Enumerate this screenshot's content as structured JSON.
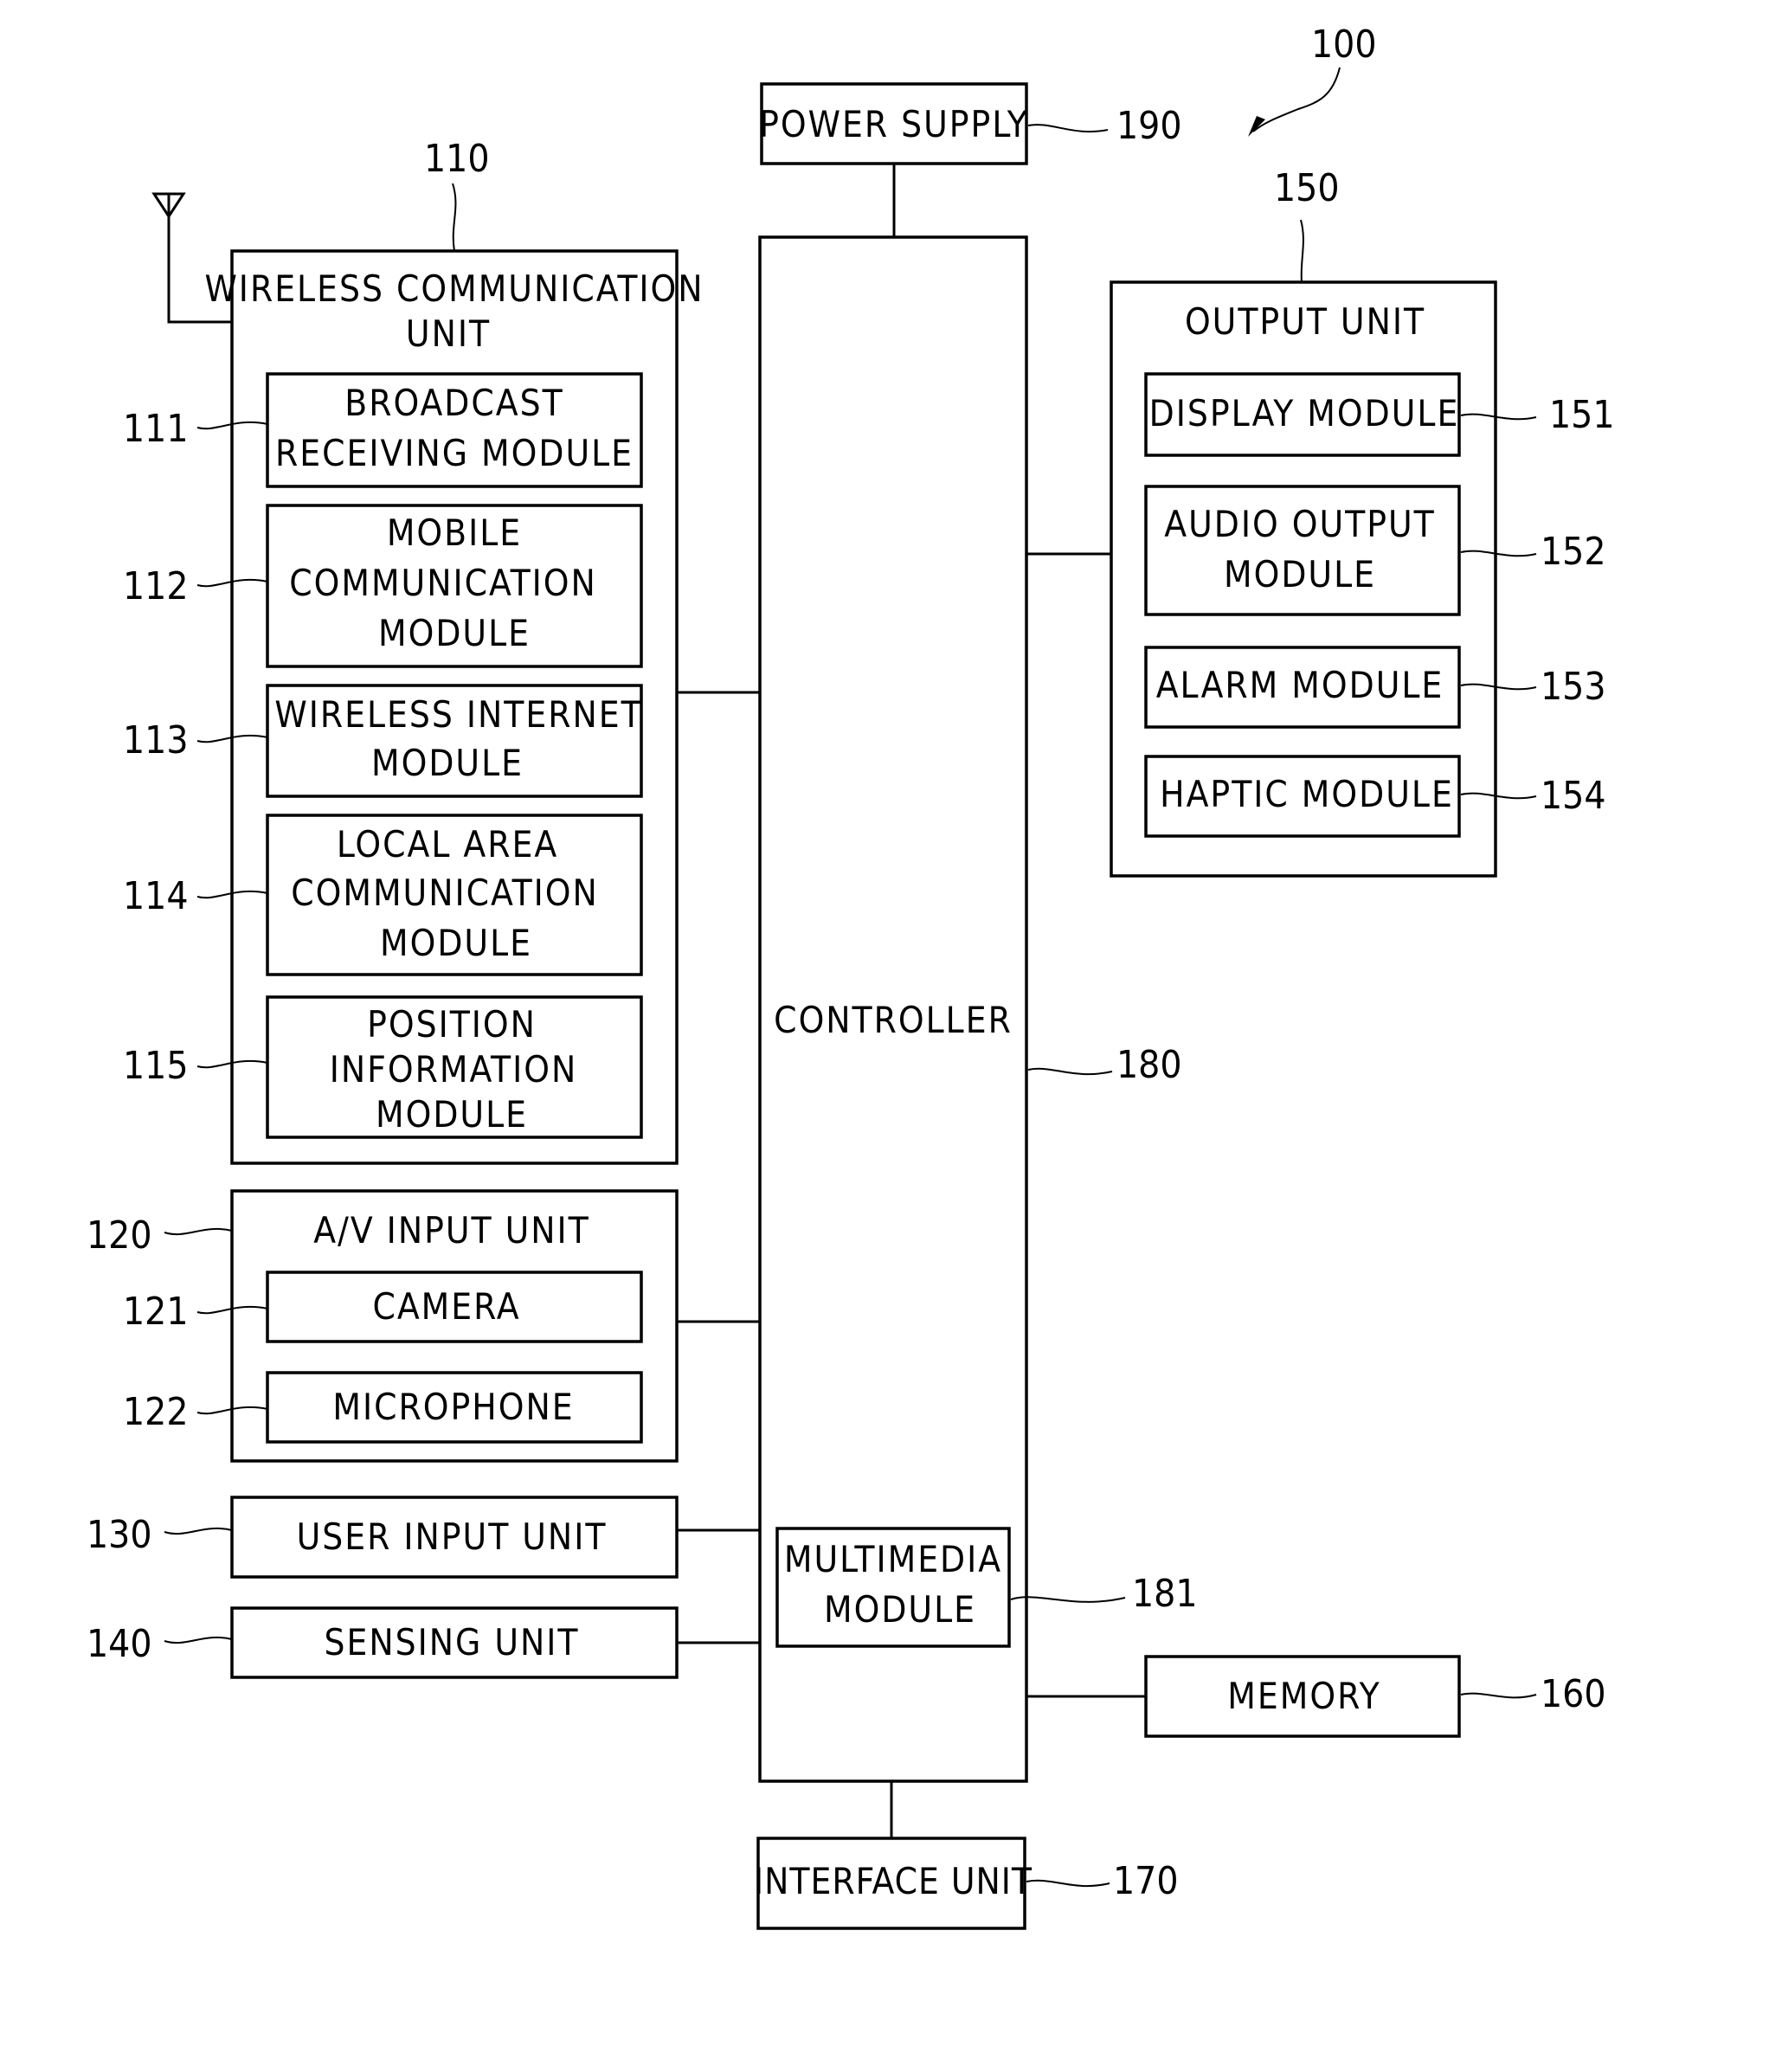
{
  "figure": {
    "device_ref": "100",
    "colors": {
      "line": "#000000",
      "background": "#ffffff"
    },
    "blocks": {
      "power_supply": {
        "ref": "190",
        "lines": [
          "POWER SUPPLY"
        ]
      },
      "wireless_unit": {
        "ref": "110",
        "lines": [
          "WIRELESS COMMUNICATION",
          "UNIT"
        ]
      },
      "broadcast": {
        "ref": "111",
        "lines": [
          "BROADCAST",
          "RECEIVING MODULE"
        ]
      },
      "mobile": {
        "ref": "112",
        "lines": [
          "MOBILE",
          "COMMUNICATION",
          "MODULE"
        ]
      },
      "wireless_internet": {
        "ref": "113",
        "lines": [
          "WIRELESS INTERNET",
          "MODULE"
        ]
      },
      "local_area": {
        "ref": "114",
        "lines": [
          "LOCAL AREA",
          "COMMUNICATION",
          "MODULE"
        ]
      },
      "position": {
        "ref": "115",
        "lines": [
          "POSITION",
          "INFORMATION",
          "MODULE"
        ]
      },
      "av_input": {
        "ref": "120",
        "lines": [
          "A/V INPUT UNIT"
        ]
      },
      "camera": {
        "ref": "121",
        "lines": [
          "CAMERA"
        ]
      },
      "microphone": {
        "ref": "122",
        "lines": [
          "MICROPHONE"
        ]
      },
      "user_input": {
        "ref": "130",
        "lines": [
          "USER INPUT UNIT"
        ]
      },
      "sensing": {
        "ref": "140",
        "lines": [
          "SENSING UNIT"
        ]
      },
      "output_unit": {
        "ref": "150",
        "lines": [
          "OUTPUT UNIT"
        ]
      },
      "display": {
        "ref": "151",
        "lines": [
          "DISPLAY MODULE"
        ]
      },
      "audio_output": {
        "ref": "152",
        "lines": [
          "AUDIO OUTPUT",
          "MODULE"
        ]
      },
      "alarm": {
        "ref": "153",
        "lines": [
          "ALARM MODULE"
        ]
      },
      "haptic": {
        "ref": "154",
        "lines": [
          "HAPTIC MODULE"
        ]
      },
      "memory": {
        "ref": "160",
        "lines": [
          "MEMORY"
        ]
      },
      "interface": {
        "ref": "170",
        "lines": [
          "INTERFACE UNIT"
        ]
      },
      "controller": {
        "ref": "180",
        "lines": [
          "CONTROLLER"
        ]
      },
      "multimedia": {
        "ref": "181",
        "lines": [
          "MULTIMEDIA",
          "MODULE"
        ]
      }
    }
  }
}
